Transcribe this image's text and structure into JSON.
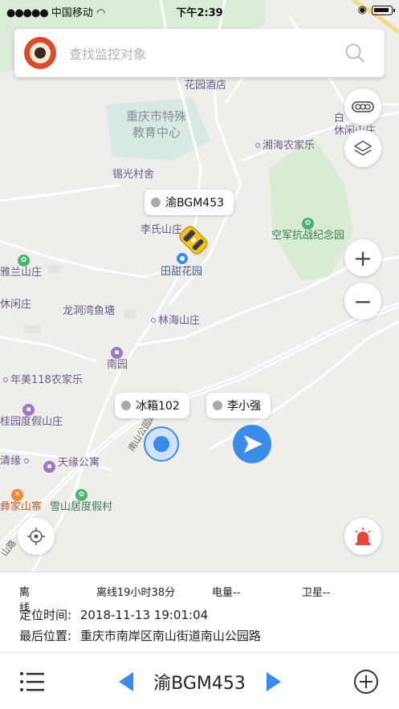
{
  "status_bar": {
    "carrier": "中国移动",
    "time": "下午2:39"
  },
  "search": {
    "placeholder": "查找监控对象"
  },
  "map": {
    "pois": [
      {
        "label": "花园酒店",
        "kind": "plain"
      },
      {
        "label": "重庆市特殊",
        "kind": "gray"
      },
      {
        "label": "教育中心",
        "kind": "gray"
      },
      {
        "label": "锡光村舍",
        "kind": "plain"
      },
      {
        "label": "湘海农家乐",
        "kind": "dot"
      },
      {
        "label": "白",
        "kind": "plain"
      },
      {
        "label": "休闲山庄",
        "kind": "plain"
      },
      {
        "label": "空军抗战纪念园",
        "kind": "green-icon"
      },
      {
        "label": "李氏山庄",
        "kind": "plain"
      },
      {
        "label": "田甜花园",
        "kind": "blue"
      },
      {
        "label": "雅兰山庄",
        "kind": "green-icon"
      },
      {
        "label": "休闲庄",
        "kind": "plain"
      },
      {
        "label": "龙洞湾鱼塘",
        "kind": "plain"
      },
      {
        "label": "林海山庄",
        "kind": "dot"
      },
      {
        "label": "南园",
        "kind": "purple-icon"
      },
      {
        "label": "年美118农家乐",
        "kind": "dot"
      },
      {
        "label": "桂园度假山庄",
        "kind": "purple-icon"
      },
      {
        "label": "清缘",
        "kind": "dot"
      },
      {
        "label": "天缘公寓",
        "kind": "purple-icon"
      },
      {
        "label": "雪山居度假村",
        "kind": "green-icon"
      },
      {
        "label": "彝家山寨",
        "kind": "orange-icon"
      },
      {
        "label": "南山公园路",
        "kind": "road"
      },
      {
        "label": "山路",
        "kind": "road"
      }
    ],
    "vehicles": [
      {
        "label": "渝BGM453"
      },
      {
        "label": "冰箱102"
      },
      {
        "label": "李小强"
      }
    ]
  },
  "buttons": {
    "traffic_icon": "traffic-icon",
    "layers_icon": "layers-icon",
    "zoom_in": "+",
    "zoom_out": "−",
    "locate_icon": "locate-icon",
    "alarm_icon": "alarm-icon"
  },
  "info": {
    "status": "离线",
    "offline_duration": "离线19小时38分",
    "power": "电量--",
    "satellite": "卫星--",
    "locate_time_label": "定位时间:",
    "locate_time": "2018-11-13 19:01:04",
    "last_location_label": "最后位置:",
    "last_location": "重庆市南岸区南山街道南山公园路"
  },
  "bottom": {
    "plate": "渝BGM453"
  },
  "colors": {
    "accent": "#3b8ce8",
    "map_bg": "#efeeea",
    "green_area": "#d8ecd5",
    "alarm": "#e8453c"
  }
}
